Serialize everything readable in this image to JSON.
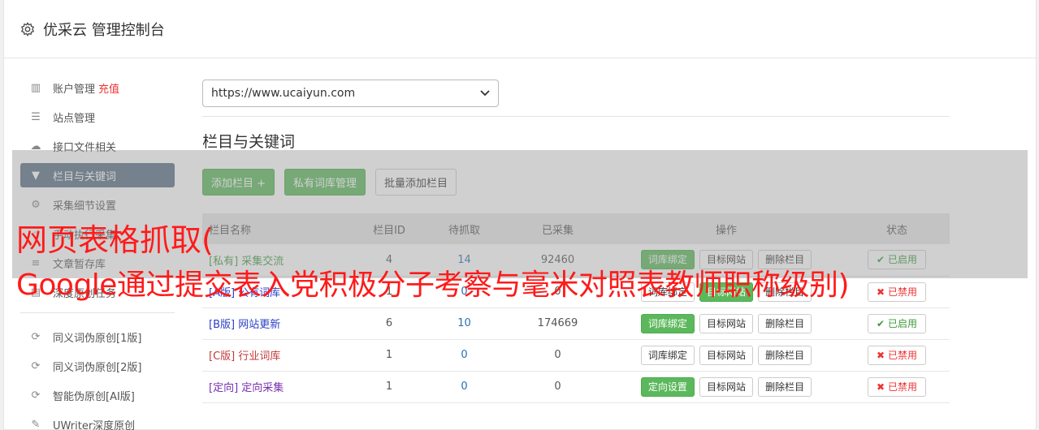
{
  "app": {
    "title": "优采云 管理控制台",
    "icon": "gear-icon"
  },
  "sidebar": {
    "items": [
      {
        "label": "账户管理",
        "extra": "充值",
        "icon": "bar-chart-icon"
      },
      {
        "label": "站点管理",
        "icon": "server-icon"
      },
      {
        "label": "接口文件相关",
        "icon": "cloud-upload-icon"
      },
      {
        "label": "栏目与关键词",
        "icon": "filter-icon",
        "active": true
      },
      {
        "label": "采集细节设置",
        "icon": "cogs-icon"
      },
      {
        "label": "手动执行采集",
        "icon": "hand-icon"
      },
      {
        "label": "文章暂存库",
        "icon": "database-icon"
      },
      {
        "label": "深度原创任务",
        "icon": "list-icon"
      }
    ],
    "items2": [
      {
        "label": "同义词伪原创[1版]",
        "icon": "refresh-icon"
      },
      {
        "label": "同义词伪原创[2版]",
        "icon": "refresh-icon"
      },
      {
        "label": "智能伪原创[AI版]",
        "icon": "refresh-icon"
      },
      {
        "label": "UWriter深度原创",
        "icon": "edit-icon"
      }
    ]
  },
  "main": {
    "site_select": "https://www.ucaiyun.com",
    "section_title": "栏目与关键词",
    "buttons": {
      "add": "添加栏目 +",
      "private_lib": "私有词库管理",
      "batch_add": "批量添加栏目"
    },
    "table": {
      "headers": {
        "name": "栏目名称",
        "id": "栏目ID",
        "pending": "待抓取",
        "collected": "已采集",
        "ops": "操作",
        "status": "状态"
      },
      "rows": [
        {
          "name": "[私有] 采集交流",
          "id": "4",
          "pending": "14",
          "collected": "92460",
          "op1": "词库绑定",
          "op2": "目标网站",
          "op3": "删除栏目",
          "status": "已启用"
        },
        {
          "name": "[A版] 公有词库",
          "id": "1",
          "pending": "0",
          "collected": "0",
          "op1": "词库绑定",
          "op2": "目标网站",
          "op3": "删除栏目",
          "status": "已禁用"
        },
        {
          "name": "[B版] 网站更新",
          "id": "6",
          "pending": "10",
          "collected": "174669",
          "op1": "词库绑定",
          "op2": "目标网站",
          "op3": "删除栏目",
          "status": "已启用"
        },
        {
          "name": "[C版] 行业词库",
          "id": "1",
          "pending": "0",
          "collected": "0",
          "op1": "词库绑定",
          "op2": "目标网站",
          "op3": "删除栏目",
          "status": "已禁用"
        },
        {
          "name": "[定向] 定向采集",
          "id": "1",
          "pending": "0",
          "collected": "0",
          "op1": "定向设置",
          "op2": "目标网站",
          "op3": "删除栏目",
          "status": "已禁用"
        }
      ]
    }
  },
  "overlay": {
    "line1": "网页表格抓取(",
    "line2": "Google通过提交表入党积极分子考察与毫米对照表教师职称级别)"
  }
}
